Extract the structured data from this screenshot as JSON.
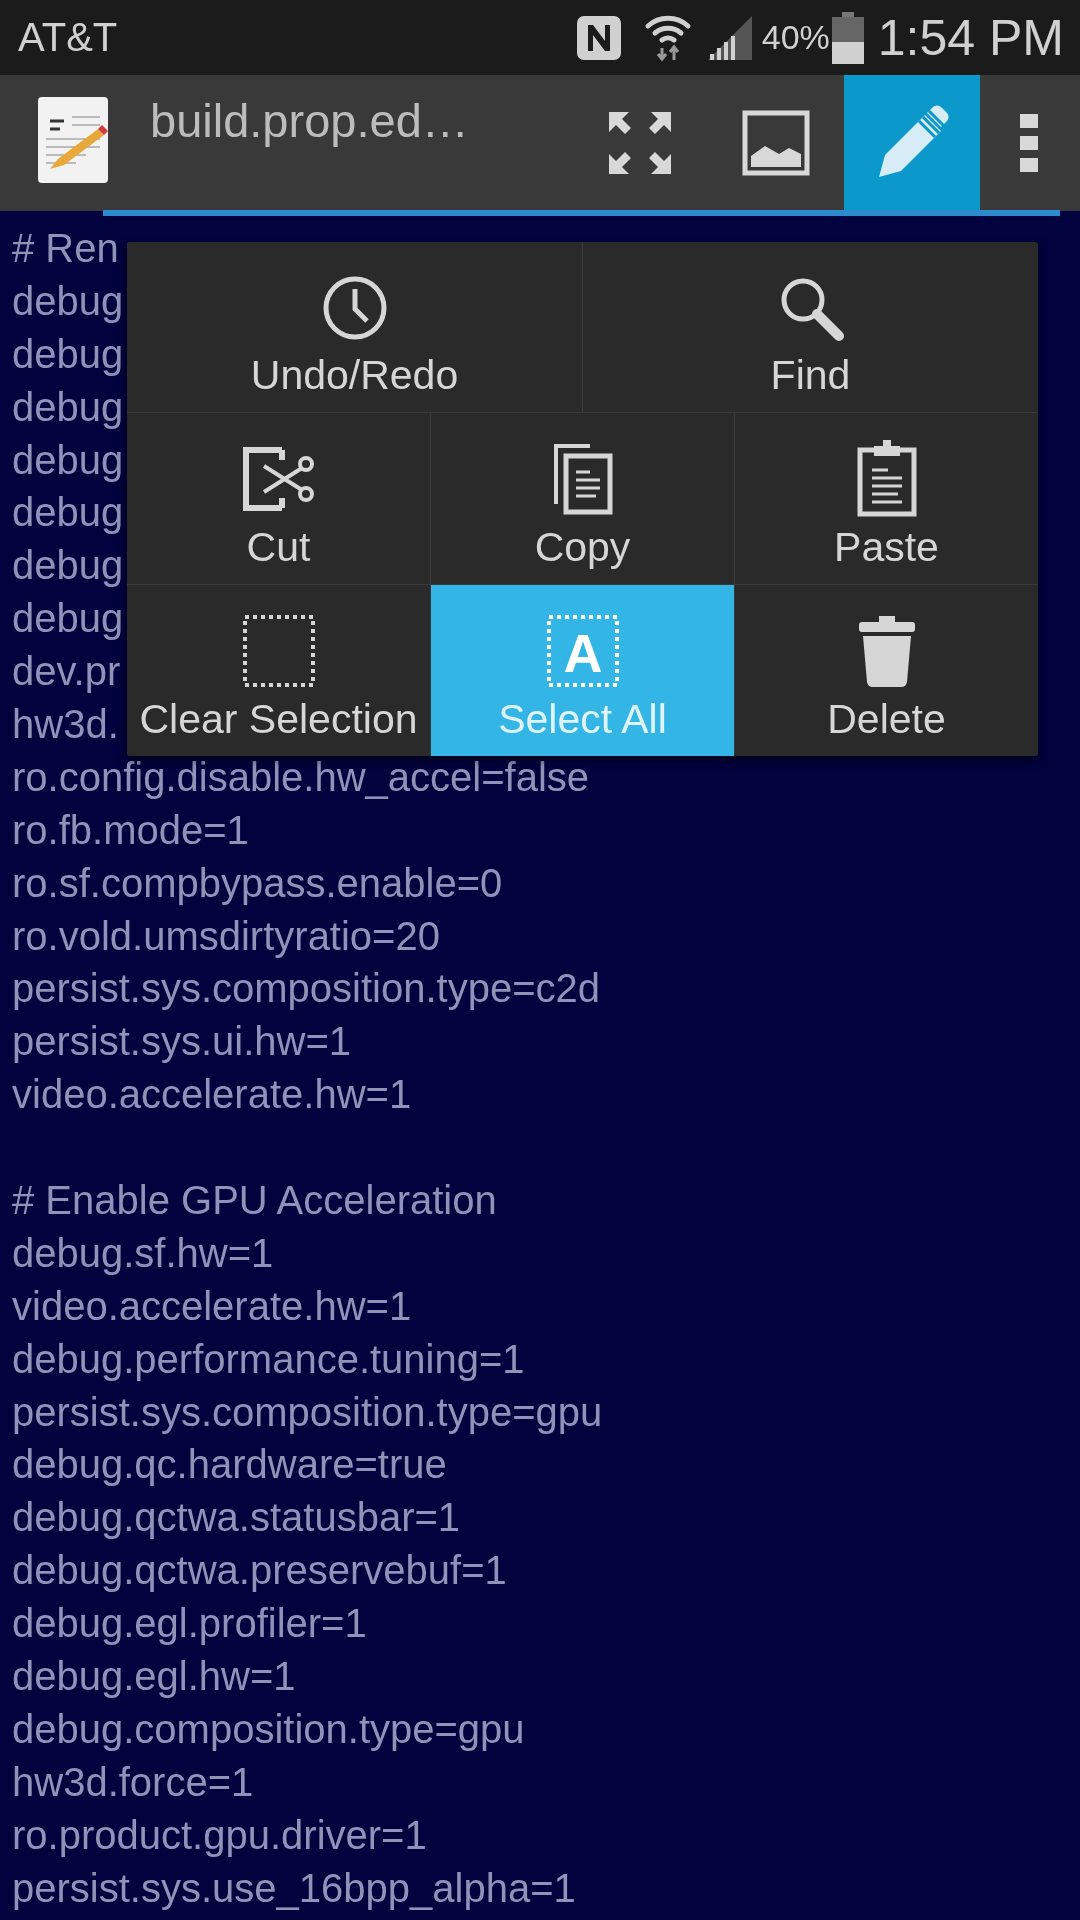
{
  "status_bar": {
    "carrier": "AT&T",
    "battery": "40%",
    "time": "1:54 PM"
  },
  "toolbar": {
    "title": "build.prop.ed…",
    "actions": [
      {
        "kind": "fullscreen",
        "selected": false
      },
      {
        "kind": "image",
        "selected": false
      },
      {
        "kind": "edit",
        "selected": true
      },
      {
        "kind": "overflow",
        "selected": false
      }
    ]
  },
  "editor": {
    "blocks": [
      {
        "lines": [
          "# Ren",
          "debug",
          "debug",
          "debug",
          "debug",
          "debug",
          "debug",
          "debug",
          "dev.pr",
          "hw3d.",
          "ro.config.disable.hw_accel=false",
          "ro.fb.mode=1",
          "ro.sf.compbypass.enable=0",
          "ro.vold.umsdirtyratio=20",
          "persist.sys.composition.type=c2d",
          "persist.sys.ui.hw=1",
          "video.accelerate.hw=1"
        ]
      },
      {
        "lines": [
          "# Enable GPU Acceleration",
          "debug.sf.hw=1",
          "video.accelerate.hw=1",
          "debug.performance.tuning=1",
          "persist.sys.composition.type=gpu",
          "debug.qc.hardware=true",
          "debug.qctwa.statusbar=1",
          "debug.qctwa.preservebuf=1",
          "debug.egl.profiler=1",
          "debug.egl.hw=1",
          "debug.composition.type=gpu",
          "hw3d.force=1",
          "ro.product.gpu.driver=1",
          "persist.sys.use_16bpp_alpha=1"
        ]
      }
    ]
  },
  "edit_menu": {
    "rows": [
      [
        {
          "kind": "undo",
          "label": "Undo/Redo",
          "selected": false
        },
        {
          "kind": "find",
          "label": "Find",
          "selected": false
        }
      ],
      [
        {
          "kind": "cut",
          "label": "Cut",
          "selected": false
        },
        {
          "kind": "copy",
          "label": "Copy",
          "selected": false
        },
        {
          "kind": "paste",
          "label": "Paste",
          "selected": false
        }
      ],
      [
        {
          "kind": "clear",
          "label": "Clear Selection",
          "selected": false
        },
        {
          "kind": "select_all",
          "label": "Select All",
          "glyph": "A",
          "selected": true
        },
        {
          "kind": "delete",
          "label": "Delete",
          "selected": false
        }
      ]
    ]
  }
}
